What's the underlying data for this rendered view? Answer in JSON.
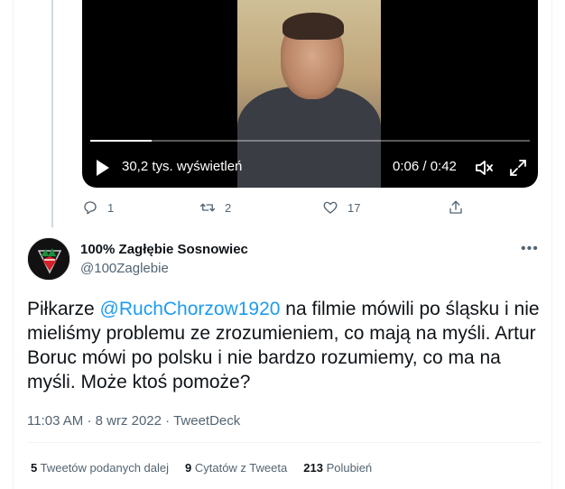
{
  "video": {
    "views": "30,2 tys. wyświetleń",
    "time": "0:06 / 0:42",
    "progress_fraction": 0.14
  },
  "actions": {
    "reply_count": "1",
    "retweet_count": "2",
    "like_count": "17"
  },
  "tweet": {
    "author_name": "100% Zagłębie Sosnowiec",
    "author_handle": "@100Zaglebie",
    "text_before": "Piłkarze ",
    "mention": "@RuchChorzow1920",
    "text_after": " na filmie mówili po śląsku i nie mieliśmy problemu ze zrozumieniem, co mają na myśli. Artur Boruc mówi po polsku i nie bardzo rozumiemy, co ma na myśli. Może ktoś pomoże?",
    "time": "11:03 AM",
    "date": "8 wrz 2022",
    "separator": "·",
    "source": "TweetDeck"
  },
  "stats": [
    {
      "count": "5",
      "label": "Tweetów podanych dalej"
    },
    {
      "count": "9",
      "label": "Cytatów z Tweeta"
    },
    {
      "count": "213",
      "label": "Polubień"
    }
  ],
  "colors": {
    "accent": "#1d9bf0",
    "text": "#0f1419",
    "secondary": "#536471",
    "border": "#eff3f4"
  },
  "icons": [
    "play-icon",
    "mute-icon",
    "fullscreen-icon",
    "reply-icon",
    "retweet-icon",
    "like-icon",
    "share-icon",
    "more-icon"
  ]
}
